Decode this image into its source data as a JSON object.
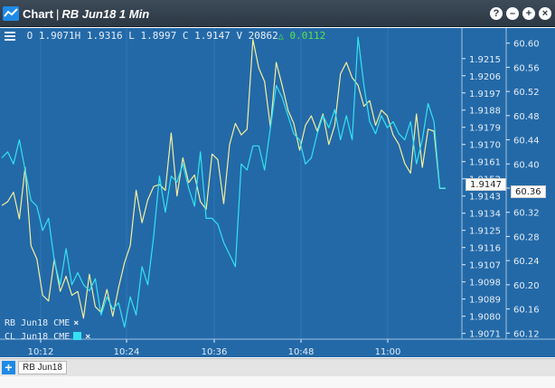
{
  "window": {
    "app_label": "Chart",
    "separator": "|",
    "symbol_title": "RB Jun18 1 Min",
    "buttons": {
      "help": "?",
      "minimize": "–",
      "maximize": "+",
      "close": "×"
    }
  },
  "ohlc": {
    "open": "O 1.9071",
    "high": "H 1.9316",
    "low": "L 1.8997",
    "close": "C 1.9147",
    "volume": "V 20862",
    "change_arrow": "△",
    "change": "0.0112"
  },
  "legend": [
    {
      "label": "RB Jun18 CME",
      "remove": "×"
    },
    {
      "label": "CL Jun18 CME",
      "remove": "×"
    }
  ],
  "last_price_tags": {
    "rb": "1.9147",
    "cl": "60.36"
  },
  "tabs": {
    "add": "+",
    "active": "RB Jun18"
  },
  "colors": {
    "background": "#2369a8",
    "rb_line": "#f4ef9a",
    "cl_line": "#33e2f2",
    "axis_text": "#e6eef6",
    "change_up": "#59e34a"
  },
  "chart_data": {
    "type": "line",
    "x_axis": {
      "ticks": [
        "10:12",
        "10:24",
        "10:36",
        "10:48",
        "11:00"
      ]
    },
    "rb_axis": {
      "ticks": [
        "1.9215",
        "1.9206",
        "1.9197",
        "1.9188",
        "1.9179",
        "1.9170",
        "1.9161",
        "1.9152",
        "1.9143",
        "1.9134",
        "1.9125",
        "1.9116",
        "1.9107",
        "1.9098",
        "1.9089",
        "1.9080",
        "1.9071"
      ],
      "ylim": [
        1.9068,
        1.9231
      ]
    },
    "cl_axis": {
      "ticks": [
        "60.60",
        "60.56",
        "60.52",
        "60.48",
        "60.44",
        "60.40",
        "60.36",
        "60.32",
        "60.28",
        "60.24",
        "60.20",
        "60.16",
        "60.12"
      ],
      "ylim": [
        60.11,
        60.625
      ]
    },
    "series": [
      {
        "name": "RB Jun18 CME",
        "axis": "rb",
        "values": [
          1.9138,
          1.914,
          1.9145,
          1.9131,
          1.9158,
          1.9117,
          1.911,
          1.9091,
          1.9088,
          1.911,
          1.9093,
          1.9101,
          1.9091,
          1.9093,
          1.9079,
          1.9102,
          1.9085,
          1.9082,
          1.9094,
          1.908,
          1.9095,
          1.9108,
          1.9117,
          1.9146,
          1.9129,
          1.9141,
          1.9148,
          1.9149,
          1.9146,
          1.9176,
          1.9143,
          1.9163,
          1.915,
          1.9154,
          1.914,
          1.9136,
          1.9165,
          1.9162,
          1.9139,
          1.917,
          1.9181,
          1.9175,
          1.9178,
          1.9225,
          1.921,
          1.9203,
          1.9179,
          1.9213,
          1.9201,
          1.9188,
          1.9181,
          1.9167,
          1.918,
          1.9185,
          1.9177,
          1.9186,
          1.917,
          1.918,
          1.9207,
          1.9213,
          1.9205,
          1.9201,
          1.919,
          1.9193,
          1.918,
          1.9188,
          1.9185,
          1.9175,
          1.917,
          1.916,
          1.9155,
          1.9186,
          1.9158,
          1.9178,
          1.9177,
          1.9147,
          1.9147
        ]
      },
      {
        "name": "CL Jun18 CME",
        "axis": "cl",
        "values": [
          60.41,
          60.42,
          60.4,
          60.44,
          60.39,
          60.34,
          60.33,
          60.29,
          60.31,
          60.24,
          60.2,
          60.26,
          60.2,
          60.22,
          60.2,
          60.19,
          60.21,
          60.15,
          60.18,
          60.16,
          60.17,
          60.13,
          60.18,
          60.15,
          60.23,
          60.2,
          60.28,
          60.38,
          60.32,
          60.38,
          60.37,
          60.4,
          60.36,
          60.33,
          60.42,
          60.31,
          60.31,
          60.3,
          60.27,
          60.25,
          60.23,
          60.4,
          60.39,
          60.43,
          60.43,
          60.39,
          60.46,
          60.53,
          60.51,
          60.48,
          60.45,
          60.44,
          60.4,
          60.41,
          60.45,
          60.48,
          60.46,
          60.49,
          60.44,
          60.48,
          60.44,
          60.61,
          60.53,
          60.47,
          60.45,
          60.48,
          60.46,
          60.47,
          60.45,
          60.44,
          60.47,
          60.4,
          60.44,
          60.5,
          60.47,
          60.36,
          60.36
        ]
      }
    ]
  }
}
